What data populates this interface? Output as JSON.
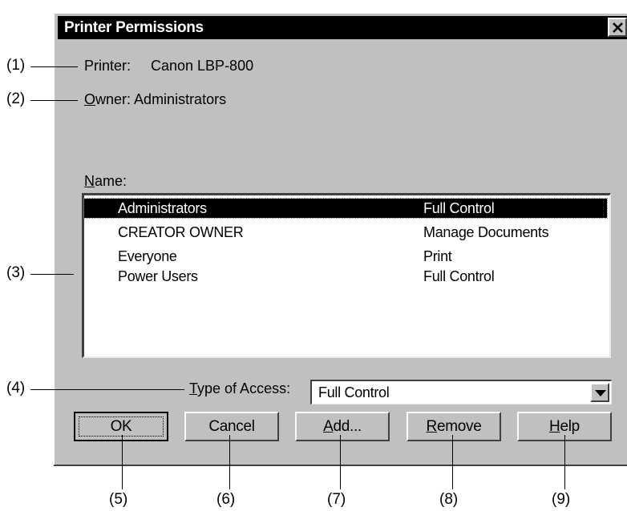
{
  "dialog": {
    "title": "Printer Permissions",
    "close_icon": "close-icon"
  },
  "printer": {
    "label": "Printer:",
    "value": "Canon LBP-800"
  },
  "owner": {
    "label_u": "O",
    "label_rest": "wner:",
    "value": "Administrators"
  },
  "name_label": {
    "u": "N",
    "rest": "ame:"
  },
  "permissions": [
    {
      "name": "Administrators",
      "permission": "Full Control",
      "selected": true
    },
    {
      "name": "CREATOR OWNER",
      "permission": "Manage Documents",
      "selected": false
    },
    {
      "name": "Everyone",
      "permission": "Print",
      "selected": false
    },
    {
      "name": "Power Users",
      "permission": "Full Control",
      "selected": false
    }
  ],
  "type_of_access": {
    "label_u": "T",
    "label_rest": "ype of Access:",
    "value": "Full Control"
  },
  "buttons": {
    "ok": "OK",
    "cancel": "Cancel",
    "add_u": "A",
    "add_rest": "dd...",
    "remove_u": "R",
    "remove_rest": "emove",
    "help_u": "H",
    "help_rest": "elp"
  },
  "callouts": [
    "(1)",
    "(2)",
    "(3)",
    "(4)",
    "(5)",
    "(6)",
    "(7)",
    "(8)",
    "(9)"
  ]
}
